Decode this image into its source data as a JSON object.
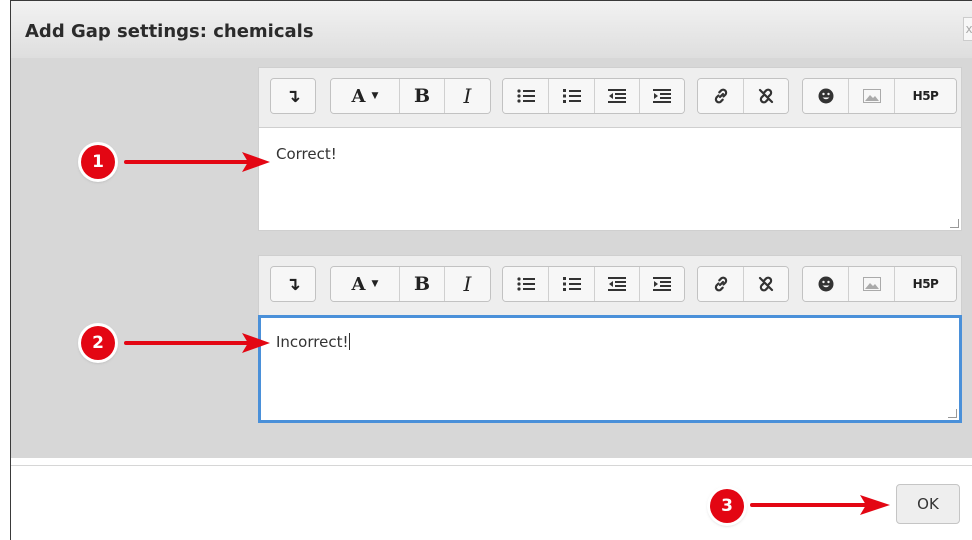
{
  "dialog": {
    "title": "Add Gap settings: chemicals",
    "close_glyph": "x",
    "ok_label": "OK"
  },
  "toolbar": {
    "groups": [
      [
        {
          "icon": "show-more-icon",
          "glyph": "↴"
        }
      ],
      [
        {
          "icon": "font-style-icon",
          "glyph": "A",
          "dropdown": "▼"
        },
        {
          "icon": "bold-icon",
          "glyph": "B"
        },
        {
          "icon": "italic-icon",
          "glyph": "I"
        }
      ],
      [
        {
          "icon": "bullet-list-icon"
        },
        {
          "icon": "numbered-list-icon"
        },
        {
          "icon": "outdent-icon"
        },
        {
          "icon": "indent-icon"
        }
      ],
      [
        {
          "icon": "link-icon"
        },
        {
          "icon": "unlink-icon"
        }
      ],
      [
        {
          "icon": "emoticon-icon"
        },
        {
          "icon": "image-icon"
        },
        {
          "icon": "h5p-icon",
          "glyph": "H5P"
        }
      ]
    ]
  },
  "editors": {
    "correct_text": "Correct!",
    "incorrect_text": "Incorrect!"
  },
  "callouts": {
    "one": "1",
    "two": "2",
    "three": "3",
    "color": "#e30613"
  }
}
